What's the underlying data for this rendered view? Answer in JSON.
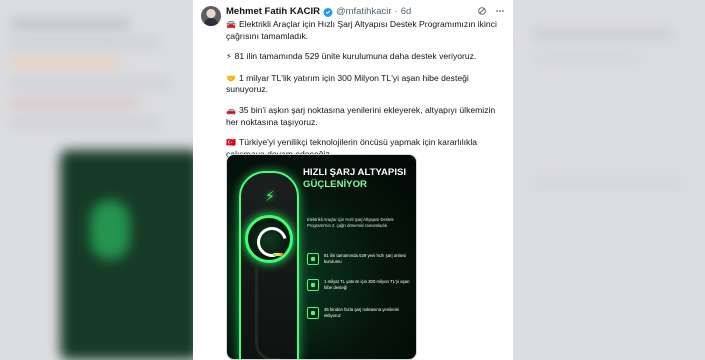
{
  "tweet": {
    "author_name": "Mehmet Fatih KACIR",
    "handle": "@mfatihkacir",
    "separator": "·",
    "time": "6d",
    "paragraphs": [
      {
        "emoji": "🚘",
        "text": "Elektrikli Araçlar için Hızlı Şarj Altyapısı Destek Programımızın ikinci çağrısını tamamladık."
      },
      {
        "emoji": "⚡",
        "text": "81 ilin tamamında 529 ünite kurulumuna daha destek veriyoruz."
      },
      {
        "emoji": "🤝",
        "text": "1 milyar TL'lik yatırım için 300 Milyon TL'yi aşan hibe desteği sunuyoruz."
      },
      {
        "emoji": "🚗",
        "text": "35 bin'i aşkın şarj noktasına yenilerini ekleyerek, altyapıyı ülkemizin her noktasına taşıyoruz."
      },
      {
        "emoji": "🇹🇷",
        "text": "Türkiye'yi yenilikçi teknolojilerin öncüsü yapmak için kararlılıkla çalışmaya devam edeceğiz."
      }
    ]
  },
  "card": {
    "title_line1": "HIZLI ŞARJ ALTYAPISI",
    "title_line2": "GÜÇLENİYOR",
    "description": "Elektrikli Araçlar için Hızlı Şarj Altyapısı Destek Programı'nın 2. çağrı dönemini tamamladık.",
    "items": [
      {
        "text": "81 ilin tamamında 529 yeni hızlı şarj ünitesi kurulumu"
      },
      {
        "text": "1 milyar TL yatırım için 300 milyon TL'yi aşan hibe desteği"
      },
      {
        "text": "35 binden fazla şarj noktasına yenilerini ekliyoruz"
      }
    ]
  },
  "colors": {
    "accent_green": "#3dff74",
    "verified_blue": "#1d9bf0",
    "text_primary": "#0f1419",
    "text_secondary": "#536471"
  },
  "icons": {
    "verified": "verified-badge-icon",
    "grok": "grok-icon",
    "more": "more-icon"
  }
}
